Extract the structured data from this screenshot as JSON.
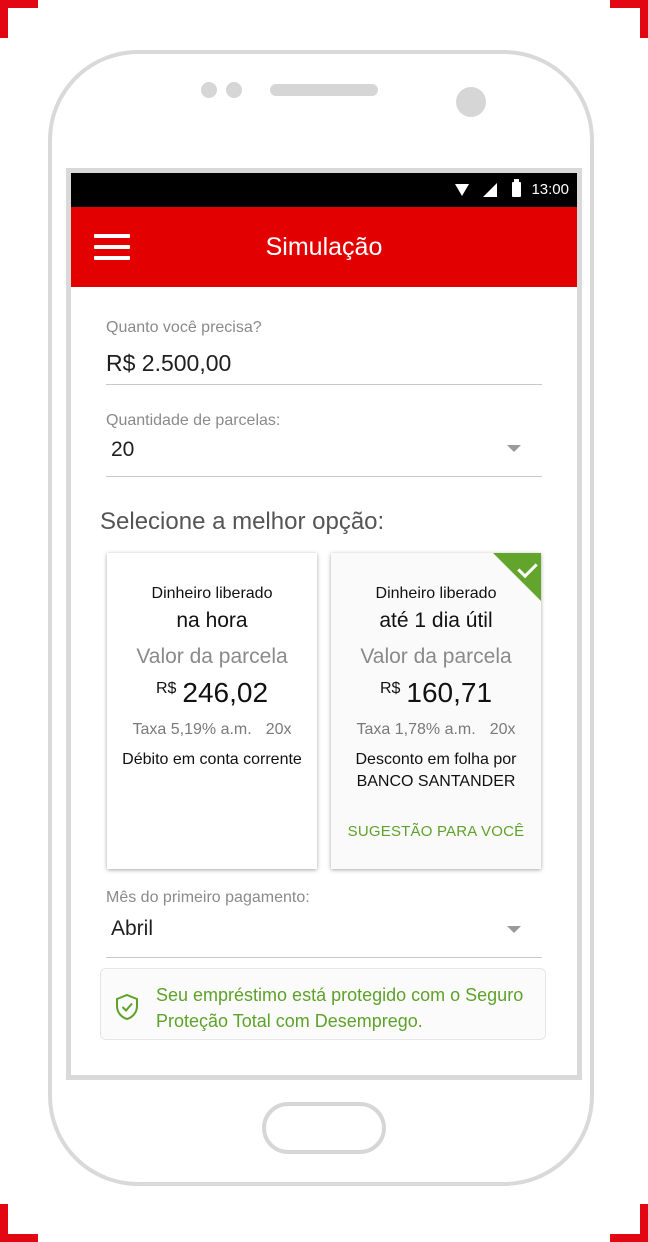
{
  "status_bar": {
    "time": "13:00"
  },
  "header": {
    "title": "Simulação"
  },
  "amount": {
    "label": "Quanto você precisa?",
    "value": "R$ 2.500,00"
  },
  "installments": {
    "label": "Quantidade de parcelas:",
    "value": "20"
  },
  "section_title": "Selecione a melhor opção:",
  "options": [
    {
      "release_label": "Dinheiro liberado",
      "release_time": "na hora",
      "installment_label": "Valor da parcela",
      "currency": "R$",
      "amount": "246,02",
      "rate": "Taxa 5,19% a.m.",
      "count": "20x",
      "description": "Débito em conta corrente",
      "selected": false
    },
    {
      "release_label": "Dinheiro liberado",
      "release_time": "até 1 dia útil",
      "installment_label": "Valor da parcela",
      "currency": "R$",
      "amount": "160,71",
      "rate": "Taxa 1,78% a.m.",
      "count": "20x",
      "description": "Desconto em folha por BANCO SANTANDER",
      "suggestion": "SUGESTÃO PARA VOCÊ",
      "selected": true
    }
  ],
  "first_payment": {
    "label": "Mês do primeiro pagamento:",
    "value": "Abril"
  },
  "protection": {
    "icon": "shield-check-icon",
    "text": "Seu empréstimo está protegido com o Seguro Proteção Total com Desemprego."
  },
  "colors": {
    "brand_red": "#e30000",
    "success_green": "#5ea22a",
    "selected_badge": "#63a52c"
  }
}
